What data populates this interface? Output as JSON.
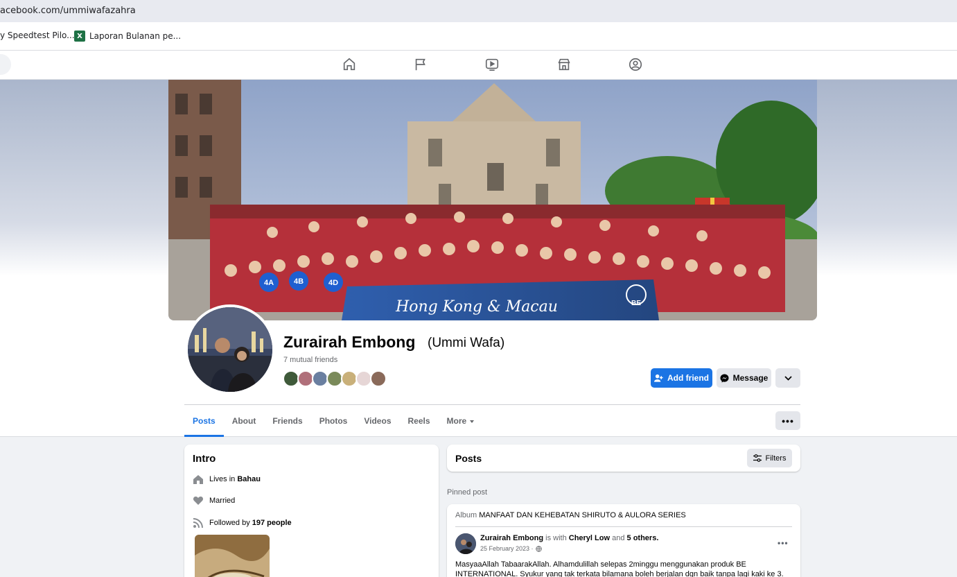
{
  "browser": {
    "url": "acebook.com/ummiwafazahra",
    "bookmarks": [
      {
        "label": "y Speedtest Pilo..."
      },
      {
        "label": "Laporan Bulanan pe...",
        "icon": "excel-icon"
      }
    ]
  },
  "nav": {
    "icons": [
      "home-icon",
      "flag-icon",
      "video-icon",
      "marketplace-icon",
      "groups-icon"
    ]
  },
  "cover": {
    "banner_text": "Hong Kong & Macau",
    "banner_logo": "BE",
    "signs": [
      "4A",
      "4B",
      "4D"
    ]
  },
  "profile": {
    "name": "Zurairah Embong",
    "alternate_name": "(Ummi Wafa)",
    "mutual_friends": "7 mutual friends",
    "friend_avatar_colors": [
      "#3f5a3a",
      "#b0707a",
      "#6a7fa0",
      "#7a8a5a",
      "#c9b07a",
      "#e6d6d6",
      "#8a6a5a"
    ]
  },
  "actions": {
    "add_friend": "Add friend",
    "message": "Message"
  },
  "tabs": [
    {
      "label": "Posts",
      "active": true
    },
    {
      "label": "About"
    },
    {
      "label": "Friends"
    },
    {
      "label": "Photos"
    },
    {
      "label": "Videos"
    },
    {
      "label": "Reels"
    },
    {
      "label": "More"
    }
  ],
  "intro": {
    "title": "Intro",
    "lives_prefix": "Lives in",
    "lives_place": "Bahau",
    "relationship": "Married",
    "followed_prefix": "Followed by",
    "followers": "197 people"
  },
  "posts": {
    "title": "Posts",
    "filters": "Filters",
    "pinned_label": "Pinned post",
    "album_prefix": "Album",
    "album_name": "MANFAAT DAN KEHEBATAN SHIRUTO & AULORA SERIES",
    "author": "Zurairah Embong",
    "with_text": "is with",
    "tagged": "Cheryl Low",
    "and_text": "and",
    "others": "5 others.",
    "date": "25 February 2023 ·",
    "body_line1": "MasyaaAllah TabaarakAllah. Alhamdulillah selepas 2minggu menggunakan produk BE",
    "body_line2": "INTERNATIONAL. Syukur yang tak terkata bilamana boleh berjalan dgn baik tanpa lagi kaki ke 3."
  },
  "colors": {
    "accent": "#1b74e4",
    "background": "#f0f2f5",
    "secondary_text": "#65676b"
  }
}
